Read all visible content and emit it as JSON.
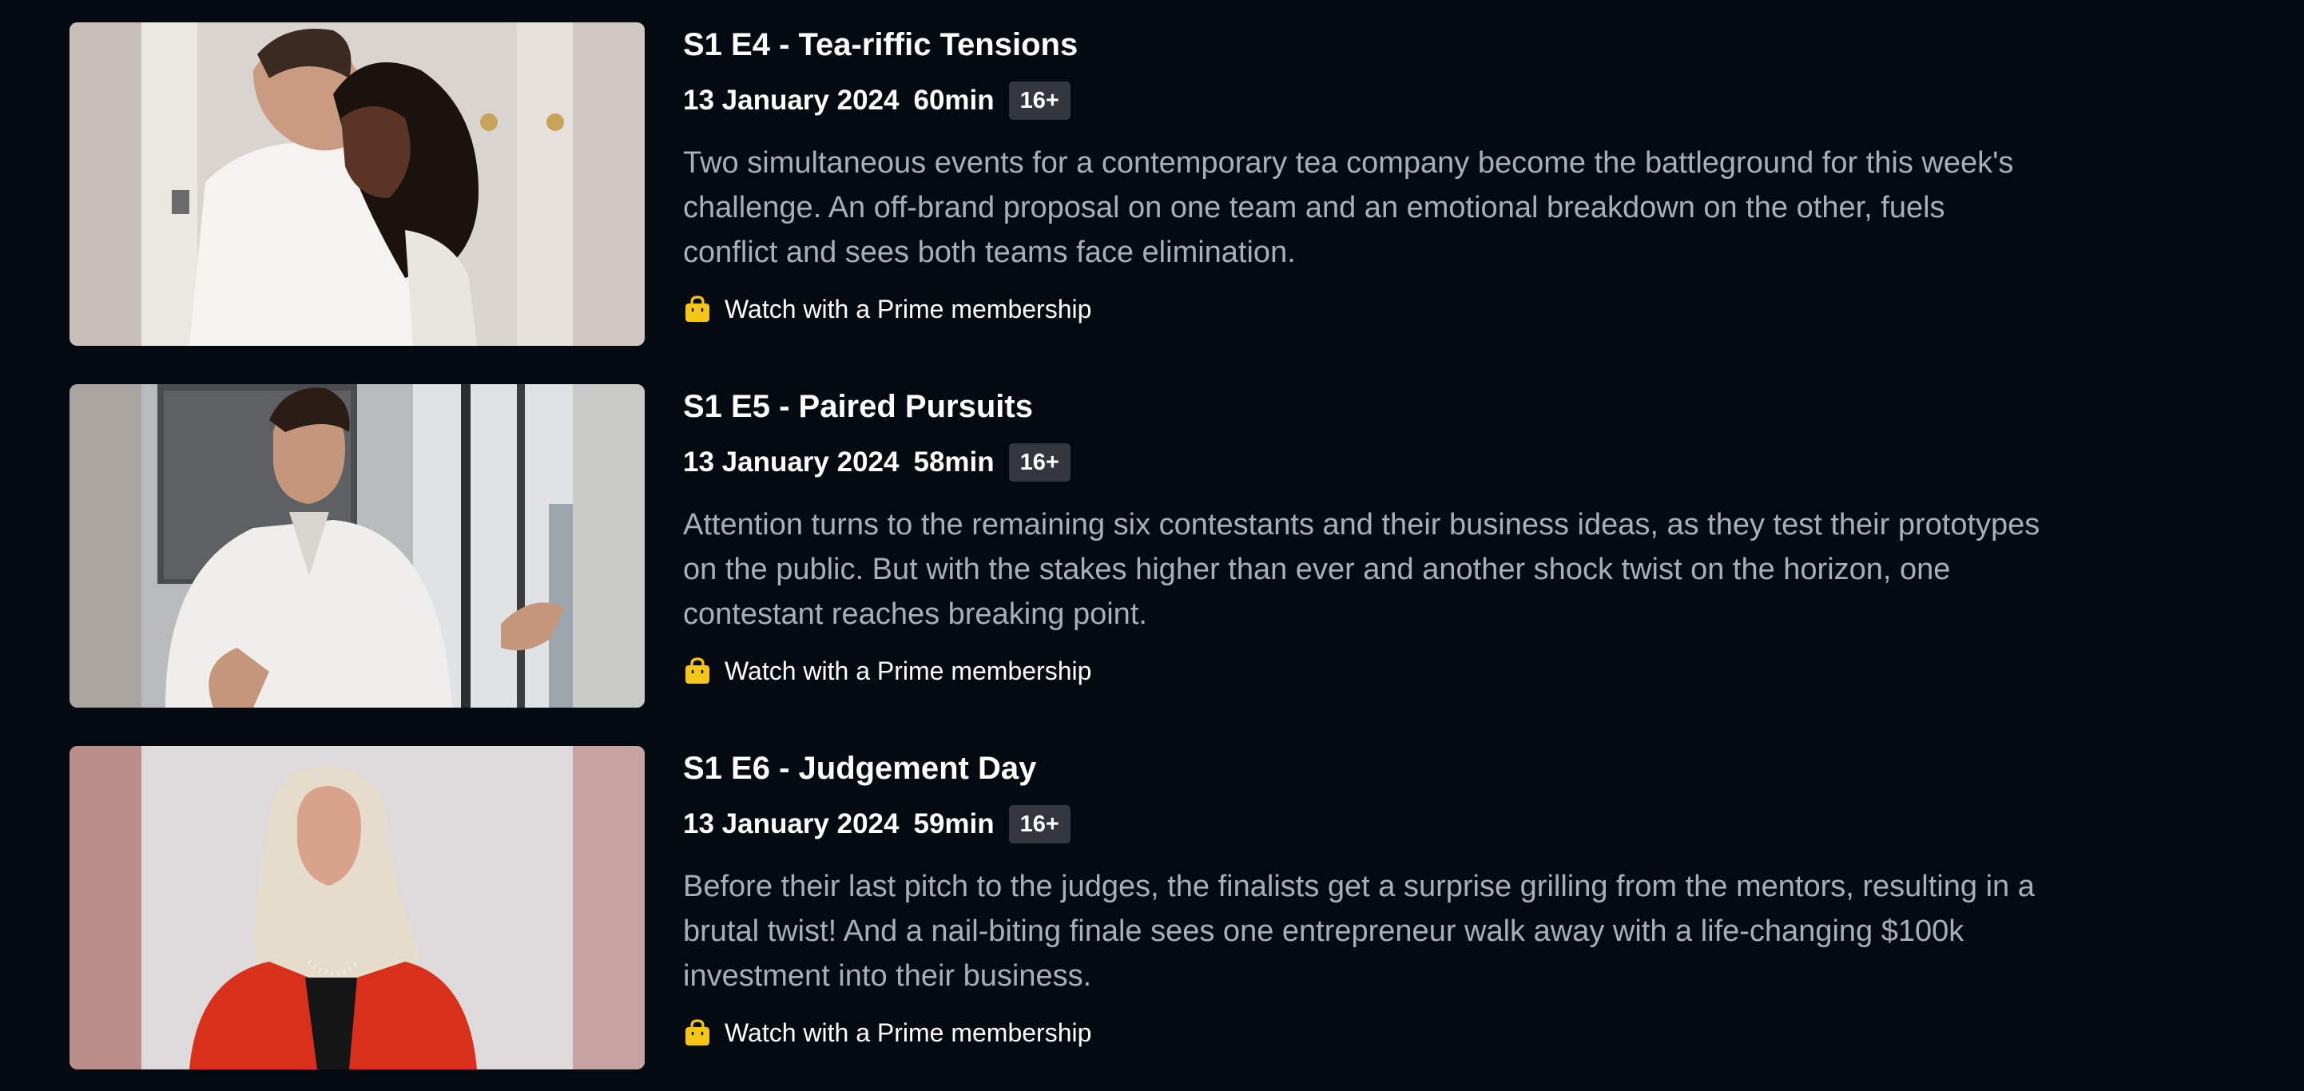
{
  "episodes": [
    {
      "title": "S1 E4 - Tea-riffic Tensions",
      "date": "13 January 2024",
      "runtime": "60min",
      "rating": "16+",
      "description": "Two simultaneous events for a contemporary tea company become the battleground for this week's challenge. An off-brand proposal on one team and an emotional breakdown on the other, fuels conflict and sees both teams face elimination.",
      "watch_label": "Watch with a Prime membership"
    },
    {
      "title": "S1 E5 - Paired Pursuits",
      "date": "13 January 2024",
      "runtime": "58min",
      "rating": "16+",
      "description": "Attention turns to the remaining six contestants and their business ideas, as they test their prototypes on the public. But with the stakes higher than ever and another shock twist on the horizon, one contestant reaches breaking point.",
      "watch_label": "Watch with a Prime membership"
    },
    {
      "title": "S1 E6 - Judgement Day",
      "date": "13 January 2024",
      "runtime": "59min",
      "rating": "16+",
      "description": "Before their last pitch to the judges, the finalists get a surprise grilling from the mentors, resulting in a brutal twist! And a nail-biting finale sees one entrepreneur walk away with a life-changing $100k investment into their business.",
      "watch_label": "Watch with a Prime membership"
    }
  ],
  "icons": {
    "prime": "shopping-bag-icon"
  },
  "colors": {
    "background": "#050a10",
    "accent": "#f5c518",
    "description_text": "#a9afb6",
    "badge_bg": "#33373d"
  }
}
